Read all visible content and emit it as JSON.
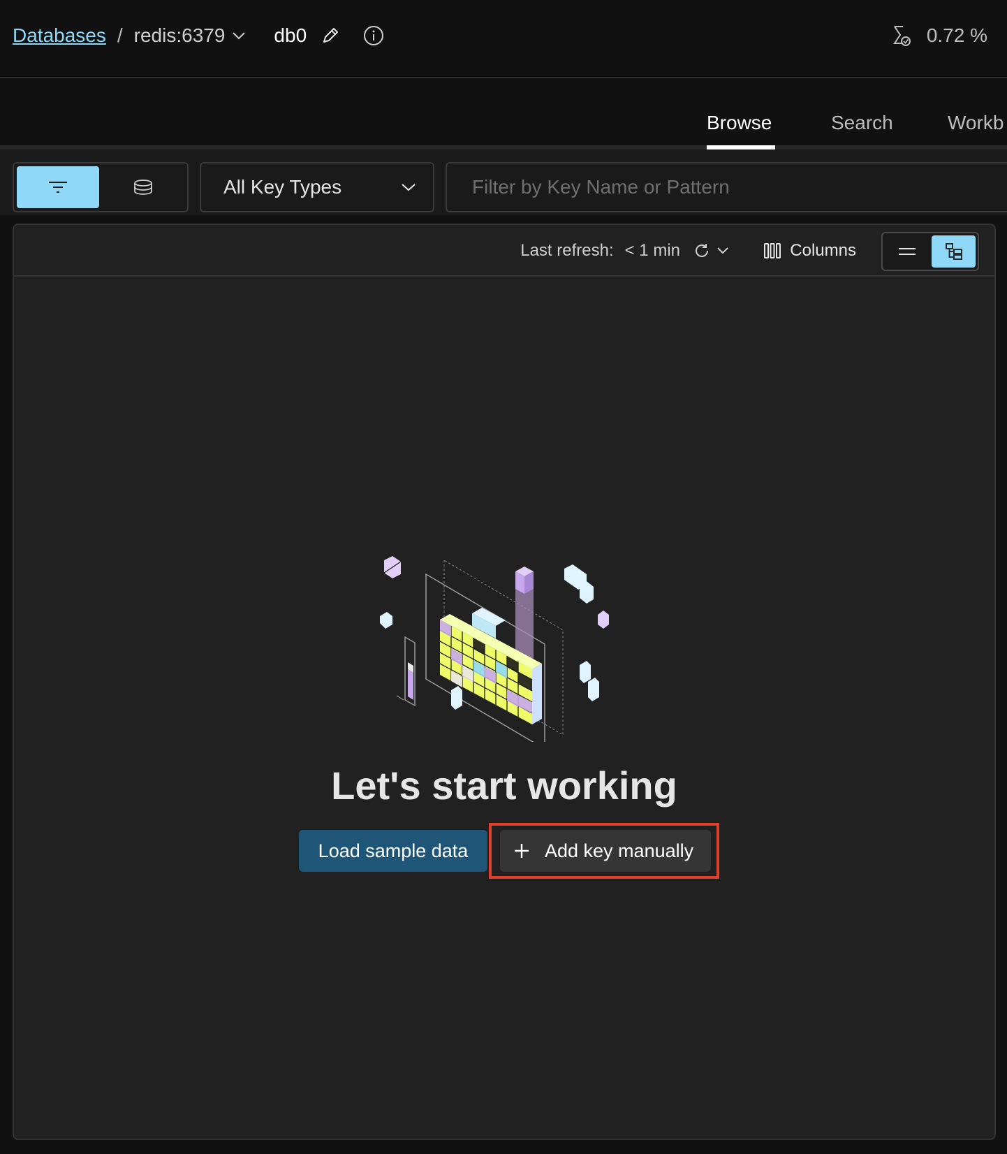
{
  "header": {
    "breadcrumb_link": "Databases",
    "breadcrumb_sep": "/",
    "database": "redis:6379",
    "db_index": "db0",
    "cpu_usage": "0.72 %"
  },
  "tabs": [
    {
      "label": "Browse",
      "active": true
    },
    {
      "label": "Search",
      "active": false
    },
    {
      "label": "Workb",
      "active": false
    }
  ],
  "toolbar": {
    "key_type": "All Key Types",
    "filter_placeholder": "Filter by Key Name or Pattern"
  },
  "panel": {
    "last_refresh_label": "Last refresh:",
    "last_refresh_value": "< 1 min",
    "columns_label": "Columns"
  },
  "empty_state": {
    "title": "Let's start working",
    "load_button": "Load sample data",
    "add_button": "Add key manually"
  },
  "colors": {
    "accent": "#8fd8f7",
    "primary_button": "#1f5677",
    "highlight": "#e0412d",
    "illustration_yellow": "#eefc6a",
    "illustration_purple": "#c9a7ee"
  }
}
